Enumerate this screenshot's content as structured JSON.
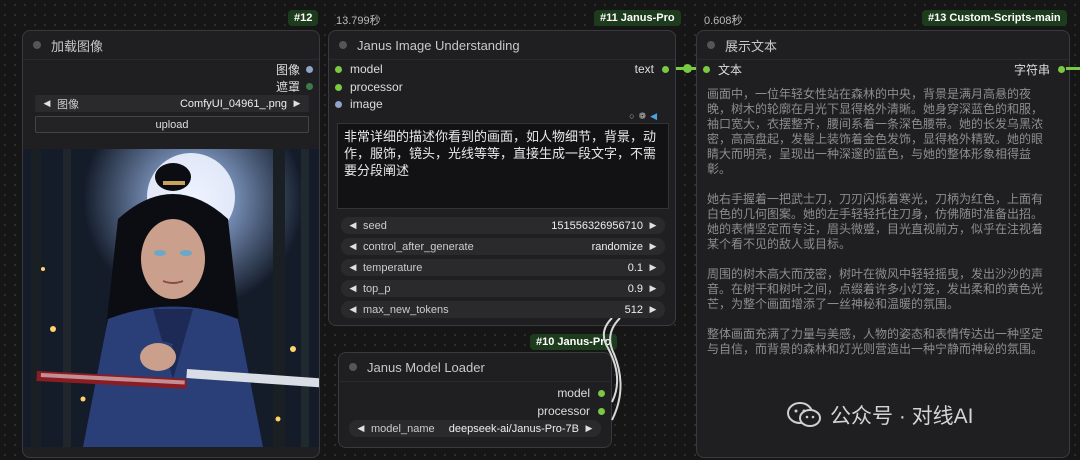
{
  "timings": {
    "janus_image": "13.799秒",
    "show_text": "0.608秒"
  },
  "load_image": {
    "badge": "#12",
    "title": "加载图像",
    "outputs": [
      "图像",
      "遮罩"
    ],
    "image_widget_label": "图像",
    "image_widget_value": "ComfyUI_04961_.png",
    "upload_label": "upload"
  },
  "janus_image": {
    "badge": "#11 Janus-Pro",
    "title": "Janus Image Understanding",
    "inputs": [
      "model",
      "processor",
      "image"
    ],
    "output": "text",
    "prompt": "非常详细的描述你看到的画面，如人物细节，背景，动作，服饰，镜头，光线等等，直接生成一段文字，不需要分段阐述",
    "widgets": [
      {
        "label": "seed",
        "value": "151556326956710"
      },
      {
        "label": "control_after_generate",
        "value": "randomize"
      },
      {
        "label": "temperature",
        "value": "0.1"
      },
      {
        "label": "top_p",
        "value": "0.9"
      },
      {
        "label": "max_new_tokens",
        "value": "512"
      }
    ]
  },
  "model_loader": {
    "badge": "#10 Janus-Pro",
    "title": "Janus Model Loader",
    "outputs": [
      "model",
      "processor"
    ],
    "widget_label": "model_name",
    "widget_value": "deepseek-ai/Janus-Pro-7B"
  },
  "show_text": {
    "badge": "#13 Custom-Scripts-main",
    "title": "展示文本",
    "input": "文本",
    "output": "字符串",
    "paragraphs": [
      "画面中，一位年轻女性站在森林的中央，背景是满月高悬的夜晚，树木的轮廓在月光下显得格外清晰。她身穿深蓝色的和服，袖口宽大，衣摆整齐，腰间系着一条深色腰带。她的长发乌黑浓密，高高盘起，发髻上装饰着金色发饰，显得格外精致。她的眼睛大而明亮，呈现出一种深邃的蓝色，与她的整体形象相得益彰。",
      "她右手握着一把武士刀，刀刃闪烁着寒光，刀柄为红色，上面有白色的几何图案。她的左手轻轻托住刀身，仿佛随时准备出招。她的表情坚定而专注，眉头微蹙，目光直视前方，似乎在注视着某个看不见的敌人或目标。",
      "周围的树木高大而茂密，树叶在微风中轻轻摇曳，发出沙沙的声音。在树干和树叶之间，点缀着许多小灯笼，发出柔和的黄色光芒，为整个画面增添了一丝神秘和温暖的氛围。",
      "整体画面充满了力量与美感，人物的姿态和表情传达出一种坚定与自信，而背景的森林和灯光则营造出一种宁静而神秘的氛围。"
    ]
  },
  "watermark": "公众号 · 对线AI",
  "colors": {
    "link": "#7ac943",
    "badge_bg": "#1d3b1d",
    "image_port": "#8fa4c8"
  }
}
